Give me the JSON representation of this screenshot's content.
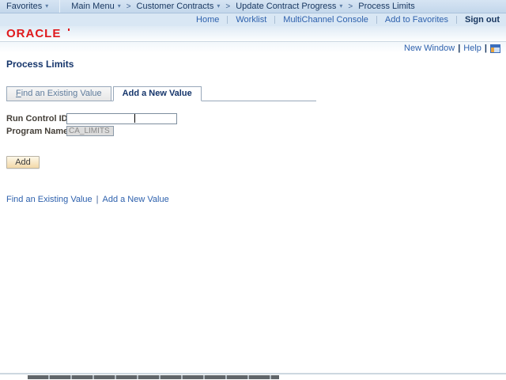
{
  "header": {
    "breadcrumb": {
      "favorites_label": "Favorites",
      "main_menu_label": "Main Menu",
      "separator": ">",
      "trail": [
        {
          "label": "Customer Contracts"
        },
        {
          "label": "Update Contract Progress"
        },
        {
          "label": "Process Limits"
        }
      ]
    },
    "links": [
      "Home",
      "Worklist",
      "MultiChannel Console",
      "Add to Favorites"
    ],
    "sign_out_label": "Sign out",
    "logo_text": "ORACLE"
  },
  "utility": {
    "new_window_label": "New Window",
    "help_label": "Help"
  },
  "page": {
    "title": "Process Limits",
    "tabs": [
      {
        "label": "Find an Existing Value",
        "active": false
      },
      {
        "label": "Add a New Value",
        "active": true
      }
    ],
    "form": {
      "run_control_label": "Run Control ID:",
      "run_control_value": "",
      "program_name_label": "Program Name:",
      "program_name_value": "CA_LIMITS"
    },
    "add_button_label": "Add",
    "footer_links": [
      "Find an Existing Value",
      "Add a New Value"
    ]
  },
  "icons": {
    "dropdown_arrow": "▾",
    "pipe": "|"
  },
  "colors": {
    "oracle_red": "#e0191c",
    "link_blue": "#2e61ad",
    "navy_text": "#17365f",
    "crumb_bar_bg": "#c3d7eb",
    "links_bar_bg": "#d9e7f4",
    "add_button_bg": "#f3d9a8"
  }
}
